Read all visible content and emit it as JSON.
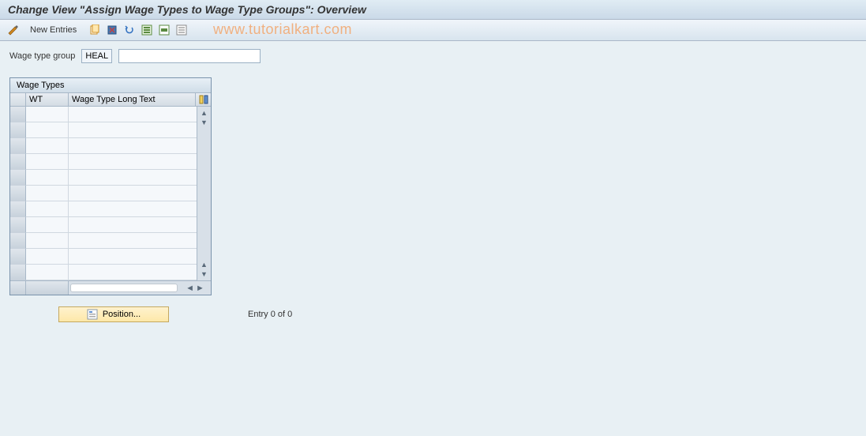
{
  "header": {
    "title": "Change View \"Assign Wage Types to Wage Type Groups\": Overview"
  },
  "toolbar": {
    "new_entries_label": "New Entries",
    "watermark": "www.tutorialkart.com"
  },
  "filter": {
    "label": "Wage type group",
    "value": "HEAL",
    "description": ""
  },
  "table": {
    "title": "Wage Types",
    "columns": {
      "wt": "WT",
      "long_text": "Wage Type Long Text"
    },
    "rows": [
      {
        "wt": "",
        "long_text": ""
      },
      {
        "wt": "",
        "long_text": ""
      },
      {
        "wt": "",
        "long_text": ""
      },
      {
        "wt": "",
        "long_text": ""
      },
      {
        "wt": "",
        "long_text": ""
      },
      {
        "wt": "",
        "long_text": ""
      },
      {
        "wt": "",
        "long_text": ""
      },
      {
        "wt": "",
        "long_text": ""
      },
      {
        "wt": "",
        "long_text": ""
      },
      {
        "wt": "",
        "long_text": ""
      },
      {
        "wt": "",
        "long_text": ""
      }
    ]
  },
  "footer": {
    "position_label": "Position...",
    "entry_status": "Entry 0 of 0"
  }
}
